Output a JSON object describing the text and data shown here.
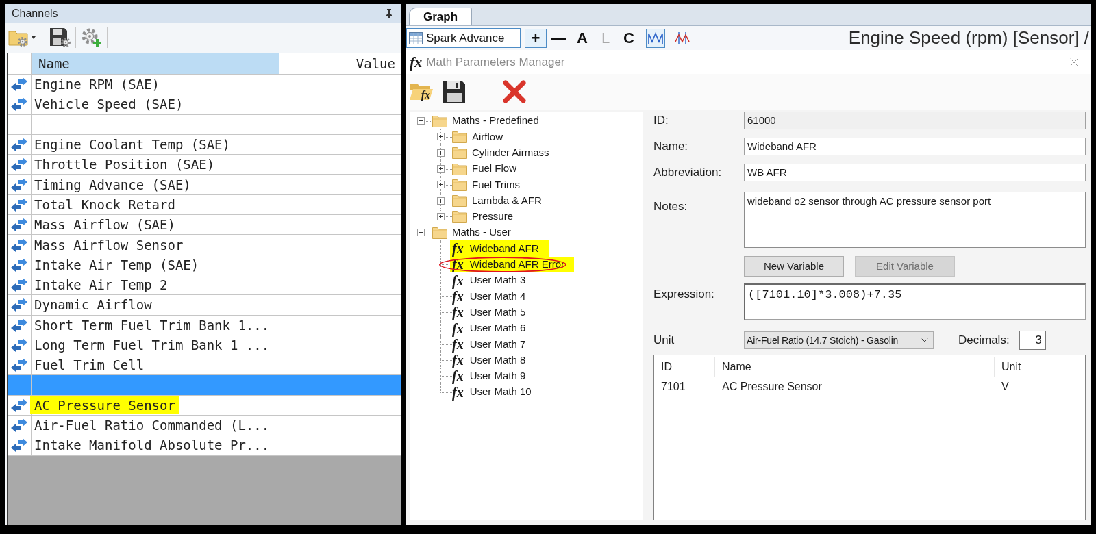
{
  "channels": {
    "title": "Channels",
    "columns": [
      {
        "label": "Name",
        "selected": true
      },
      {
        "label": "Value",
        "selected": false
      }
    ],
    "rows": [
      {
        "kind": "channel",
        "name": "Engine RPM (SAE)",
        "selected": false,
        "highlighted": false
      },
      {
        "kind": "channel",
        "name": "Vehicle Speed (SAE)",
        "selected": false,
        "highlighted": false
      },
      {
        "kind": "blank",
        "selected": false
      },
      {
        "kind": "channel",
        "name": "Engine Coolant Temp (SAE)",
        "selected": false,
        "highlighted": false
      },
      {
        "kind": "channel",
        "name": "Throttle Position (SAE)",
        "selected": false,
        "highlighted": false
      },
      {
        "kind": "channel",
        "name": "Timing Advance (SAE)",
        "selected": false,
        "highlighted": false
      },
      {
        "kind": "channel",
        "name": "Total Knock Retard",
        "selected": false,
        "highlighted": false
      },
      {
        "kind": "channel",
        "name": "Mass Airflow (SAE)",
        "selected": false,
        "highlighted": false
      },
      {
        "kind": "channel",
        "name": "Mass Airflow Sensor",
        "selected": false,
        "highlighted": false
      },
      {
        "kind": "channel",
        "name": "Intake Air Temp (SAE)",
        "selected": false,
        "highlighted": false
      },
      {
        "kind": "channel",
        "name": "Intake Air Temp 2",
        "selected": false,
        "highlighted": false
      },
      {
        "kind": "channel",
        "name": "Dynamic Airflow",
        "selected": false,
        "highlighted": false
      },
      {
        "kind": "channel",
        "name": "Short Term Fuel Trim Bank 1...",
        "selected": false,
        "highlighted": false
      },
      {
        "kind": "channel",
        "name": "Long Term Fuel Trim Bank 1 ...",
        "selected": false,
        "highlighted": false
      },
      {
        "kind": "channel",
        "name": "Fuel Trim Cell",
        "selected": false,
        "highlighted": false
      },
      {
        "kind": "blank",
        "selected": true
      },
      {
        "kind": "channel",
        "name": "AC Pressure Sensor",
        "selected": false,
        "highlighted": true
      },
      {
        "kind": "channel",
        "name": "Air-Fuel Ratio Commanded (L...",
        "selected": false,
        "highlighted": false
      },
      {
        "kind": "channel",
        "name": "Intake Manifold Absolute Pr...",
        "selected": false,
        "highlighted": false
      }
    ]
  },
  "graph": {
    "tabs": [
      {
        "label": "Graph",
        "selected": true
      }
    ],
    "table_button": "Spark Advance",
    "tools": [
      {
        "kind": "text",
        "label": "+",
        "selected": true,
        "disabled": false
      },
      {
        "kind": "text",
        "label": "—",
        "selected": false,
        "disabled": false
      },
      {
        "kind": "text",
        "label": "A",
        "selected": false,
        "disabled": false
      },
      {
        "kind": "text",
        "label": "L",
        "selected": false,
        "disabled": true
      },
      {
        "kind": "text",
        "label": "C",
        "selected": false,
        "disabled": false
      },
      {
        "kind": "icon",
        "selected": true,
        "disabled": false
      },
      {
        "kind": "icon",
        "selected": false,
        "disabled": false
      }
    ],
    "axis_title": "Engine Speed (rpm) [Sensor] /"
  },
  "dialog": {
    "title_glyph": "fx",
    "title": "Math Parameters Manager",
    "toolbar": [
      {
        "kind": "open",
        "glyph": "fx"
      },
      {
        "kind": "save"
      },
      {
        "kind": "delete"
      }
    ],
    "tree": [
      {
        "kind": "folder",
        "label": "Maths - Predefined",
        "expanded": true,
        "children": [
          {
            "kind": "folder",
            "label": "Airflow",
            "expanded": false
          },
          {
            "kind": "folder",
            "label": "Cylinder Airmass",
            "expanded": false
          },
          {
            "kind": "folder",
            "label": "Fuel Flow",
            "expanded": false
          },
          {
            "kind": "folder",
            "label": "Fuel Trims",
            "expanded": false
          },
          {
            "kind": "folder",
            "label": "Lambda & AFR",
            "expanded": false
          },
          {
            "kind": "folder",
            "label": "Pressure",
            "expanded": false
          }
        ]
      },
      {
        "kind": "folder",
        "label": "Maths - User",
        "expanded": true,
        "children": [
          {
            "kind": "math",
            "glyph": "fx",
            "label": "Wideband AFR",
            "highlighted": true,
            "circled": false
          },
          {
            "kind": "math",
            "glyph": "fx",
            "label": "Wideband AFR Error",
            "highlighted": true,
            "circled": true
          },
          {
            "kind": "math",
            "glyph": "fx",
            "label": "User Math 3",
            "highlighted": false,
            "circled": false
          },
          {
            "kind": "math",
            "glyph": "fx",
            "label": "User Math 4",
            "highlighted": false,
            "circled": false
          },
          {
            "kind": "math",
            "glyph": "fx",
            "label": "User Math 5",
            "highlighted": false,
            "circled": false
          },
          {
            "kind": "math",
            "glyph": "fx",
            "label": "User Math 6",
            "highlighted": false,
            "circled": false
          },
          {
            "kind": "math",
            "glyph": "fx",
            "label": "User Math 7",
            "highlighted": false,
            "circled": false
          },
          {
            "kind": "math",
            "glyph": "fx",
            "label": "User Math 8",
            "highlighted": false,
            "circled": false
          },
          {
            "kind": "math",
            "glyph": "fx",
            "label": "User Math 9",
            "highlighted": false,
            "circled": false
          },
          {
            "kind": "math",
            "glyph": "fx",
            "label": "User Math 10",
            "highlighted": false,
            "circled": false
          }
        ]
      }
    ],
    "fields": [
      {
        "kind": "readonly",
        "label": "ID:",
        "value": "61000"
      },
      {
        "kind": "text",
        "label": "Name:",
        "value": "Wideband AFR"
      },
      {
        "kind": "text",
        "label": "Abbreviation:",
        "value": "WB AFR"
      },
      {
        "kind": "textarea",
        "label": "Notes:",
        "value": "wideband o2 sensor through AC pressure sensor port"
      }
    ],
    "buttons": [
      {
        "label": "New Variable",
        "disabled": false
      },
      {
        "label": "Edit Variable",
        "disabled": true
      }
    ],
    "expression": {
      "label": "Expression:",
      "value": "([7101.10]*3.008)+7.35"
    },
    "unit": {
      "label": "Unit",
      "value": "Air-Fuel Ratio (14.7 Stoich) - Gasolin"
    },
    "decimals": {
      "label": "Decimals:",
      "value": "3"
    },
    "variables": {
      "columns": [
        "ID",
        "Name",
        "Unit"
      ],
      "rows": [
        [
          "7101",
          "AC Pressure Sensor",
          "V"
        ]
      ]
    }
  }
}
